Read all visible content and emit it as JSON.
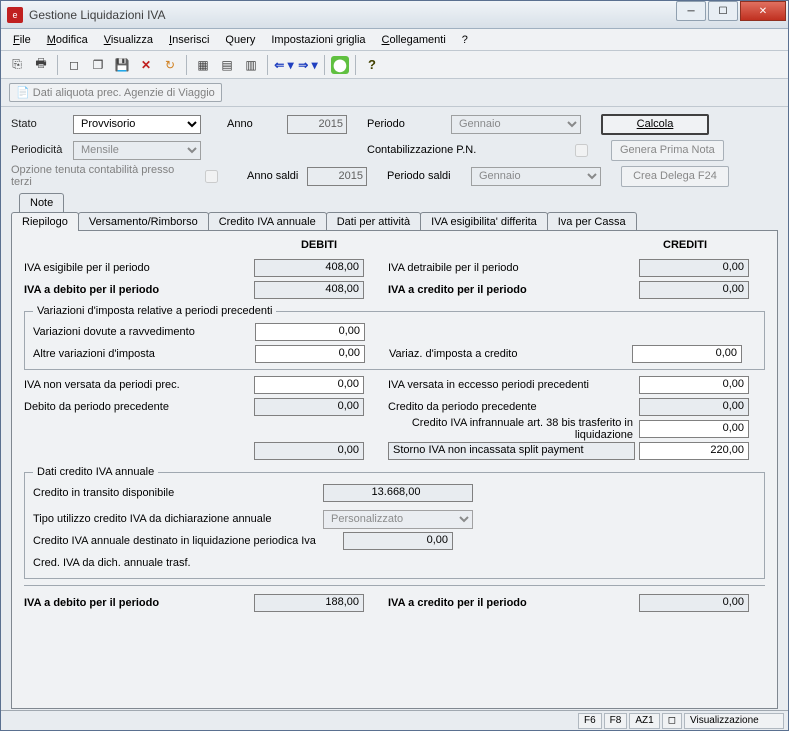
{
  "window": {
    "title": "Gestione Liquidazioni IVA"
  },
  "menu": {
    "file": "File",
    "file_u": "F",
    "modifica": "Modifica",
    "modifica_u": "M",
    "visualizza": "Visualizza",
    "visualizza_u": "V",
    "inserisci": "Inserisci",
    "inserisci_u": "I",
    "query": "Query",
    "impostazioni": "Impostazioni griglia",
    "impostazioni_u": "g",
    "collegamenti": "Collegamenti",
    "collegamenti_u": "C",
    "help": "?"
  },
  "subtoolbar": {
    "aliquota": "Dati aliquota prec. Agenzie di Viaggio"
  },
  "form": {
    "stato_lbl": "Stato",
    "stato_val": "Provvisorio",
    "periodicita_lbl": "Periodicità",
    "periodicita_val": "Mensile",
    "opzione_lbl": "Opzione tenuta contabilità presso terzi",
    "anno_lbl": "Anno",
    "anno_val": "2015",
    "anno_saldi_lbl": "Anno saldi",
    "anno_saldi_val": "2015",
    "periodo_lbl": "Periodo",
    "periodo_val": "Gennaio",
    "contab_lbl": "Contabilizzazione P.N.",
    "periodo_saldi_lbl": "Periodo saldi",
    "periodo_saldi_val": "Gennaio"
  },
  "buttons": {
    "calcola": "Calcola",
    "genera_pn": "Genera Prima Nota",
    "crea_delega": "Crea Delega F24"
  },
  "tabs": {
    "note": "Note",
    "riepilogo": "Riepilogo",
    "versamento": "Versamento/Rimborso",
    "credito_annuale": "Credito IVA annuale",
    "dati_attivita": "Dati per attività",
    "esigibilita": "IVA esigibilita' differita",
    "iva_cassa": "Iva per Cassa"
  },
  "headers": {
    "debiti": "DEBITI",
    "crediti": "CREDITI"
  },
  "rows": {
    "iva_esigibile_lbl": "IVA esigibile per il periodo",
    "iva_esigibile_val": "408,00",
    "iva_detraibile_lbl": "IVA detraibile per il periodo",
    "iva_detraibile_val": "0,00",
    "iva_debito_lbl": "IVA a debito per il periodo",
    "iva_debito_val": "408,00",
    "iva_credito_lbl": "IVA a credito per il periodo",
    "iva_credito_val": "0,00",
    "variazioni_legend": "Variazioni d'imposta relative a periodi precedenti",
    "var_ravv_lbl": "Variazioni dovute a ravvedimento",
    "var_ravv_val": "0,00",
    "altre_var_lbl": "Altre variazioni d'imposta",
    "altre_var_val": "0,00",
    "var_credito_lbl": "Variaz. d'imposta a credito",
    "var_credito_val": "0,00",
    "iva_non_versata_lbl": "IVA non versata da periodi prec.",
    "iva_non_versata_val": "0,00",
    "iva_eccesso_lbl": "IVA versata in eccesso periodi precedenti",
    "iva_eccesso_val": "0,00",
    "debito_prec_lbl": "Debito da periodo precedente",
    "debito_prec_val": "0,00",
    "credito_prec_lbl": "Credito da periodo precedente",
    "credito_prec_val": "0,00",
    "credito_38bis_lbl": "Credito IVA infrannuale art. 38 bis trasferito in liquidazione",
    "credito_38bis_val": "0,00",
    "unnamed_val": "0,00",
    "storno_lbl": "Storno IVA non incassata split payment",
    "storno_val": "220,00",
    "dati_credito_legend": "Dati credito IVA annuale",
    "credito_transito_lbl": "Credito in transito disponibile",
    "credito_transito_val": "13.668,00",
    "tipo_utilizzo_lbl": "Tipo utilizzo credito IVA da dichiarazione annuale",
    "tipo_utilizzo_val": "Personalizzato",
    "credito_liq_lbl": "Credito IVA annuale destinato in liquidazione periodica Iva",
    "credito_liq_val": "0,00",
    "cred_trasf_lbl": "Cred. IVA da dich. annuale trasf.",
    "iva_debito_fin_lbl": "IVA a debito per il periodo",
    "iva_debito_fin_val": "188,00",
    "iva_credito_fin_lbl": "IVA a credito per il periodo",
    "iva_credito_fin_val": "0,00"
  },
  "status": {
    "f6": "F6",
    "f8": "F8",
    "az1": "AZ1",
    "mode": "Visualizzazione"
  }
}
